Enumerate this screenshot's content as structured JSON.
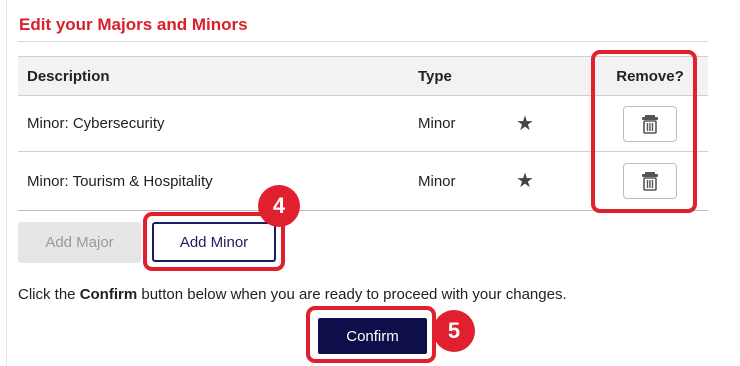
{
  "section_title": "Edit your Majors and Minors",
  "table": {
    "headers": {
      "description": "Description",
      "type": "Type",
      "remove": "Remove?"
    },
    "rows": [
      {
        "description": "Minor: Cybersecurity",
        "type": "Minor",
        "icon": "star-icon",
        "remove_icon": "trash-icon"
      },
      {
        "description": "Minor: Tourism & Hospitality",
        "type": "Minor",
        "icon": "star-icon",
        "remove_icon": "trash-icon"
      }
    ]
  },
  "buttons": {
    "add_major": "Add Major",
    "add_minor": "Add Minor",
    "confirm": "Confirm"
  },
  "instruction": {
    "before": "Click the ",
    "bold": "Confirm",
    "after": " button below when you are ready to proceed with your changes."
  },
  "annotations": {
    "step_add_minor": "4",
    "step_confirm": "5"
  },
  "colors": {
    "title_red": "#d81f2a",
    "highlight_red": "#e0202e",
    "navy": "#0e0e4a",
    "disabled_gray": "#e6e6e6"
  }
}
